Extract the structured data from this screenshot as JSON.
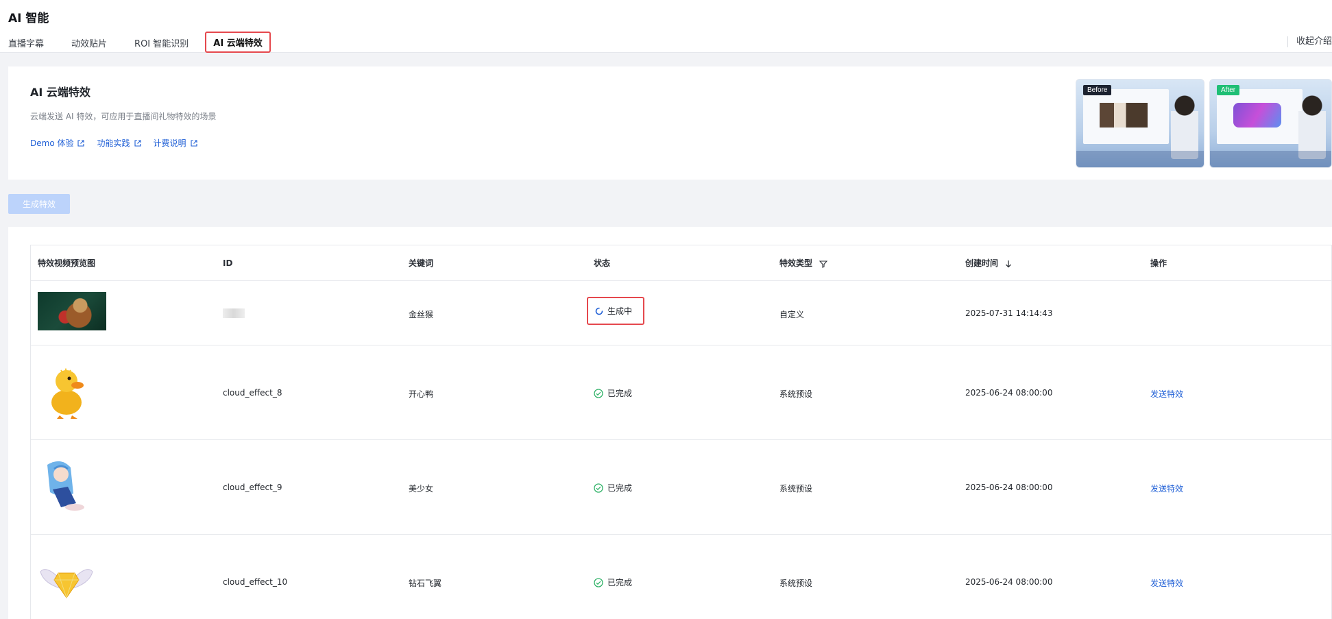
{
  "header": {
    "title": "AI 智能",
    "tabs": [
      "直播字幕",
      "动效贴片",
      "ROI 智能识别",
      "AI 云端特效"
    ],
    "collapse_label": "收起介绍"
  },
  "intro": {
    "title": "AI 云端特效",
    "description": "云端发送 AI 特效，可应用于直播间礼物特效的场景",
    "links": [
      "Demo 体验",
      "功能实践",
      "计费说明"
    ],
    "preview_before": "Before",
    "preview_after": "After"
  },
  "toolbar": {
    "generate_label": "生成特效"
  },
  "table": {
    "columns": [
      "特效视频预览图",
      "ID",
      "关键词",
      "状态",
      "特效类型",
      "创建时间",
      "操作"
    ],
    "rows": [
      {
        "thumb": "monkey",
        "id": "",
        "keyword": "金丝猴",
        "status": "生成中",
        "type": "自定义",
        "created": "2025-07-31 14:14:43",
        "action": ""
      },
      {
        "thumb": "duck",
        "id": "cloud_effect_8",
        "keyword": "开心鸭",
        "status": "已完成",
        "type": "系统预设",
        "created": "2025-06-24 08:00:00",
        "action": "发送特效"
      },
      {
        "thumb": "girl",
        "id": "cloud_effect_9",
        "keyword": "美少女",
        "status": "已完成",
        "type": "系统预设",
        "created": "2025-06-24 08:00:00",
        "action": "发送特效"
      },
      {
        "thumb": "wings",
        "id": "cloud_effect_10",
        "keyword": "钻石飞翼",
        "status": "已完成",
        "type": "系统预设",
        "created": "2025-06-24 08:00:00",
        "action": "发送特效"
      }
    ]
  },
  "colors": {
    "accent": "#1f5fd6",
    "success": "#2fb267",
    "highlight": "#e5484d"
  },
  "icons": [
    "external-link-icon",
    "filter-icon",
    "sort-down-icon",
    "loading-spinner-icon",
    "check-circle-icon"
  ]
}
